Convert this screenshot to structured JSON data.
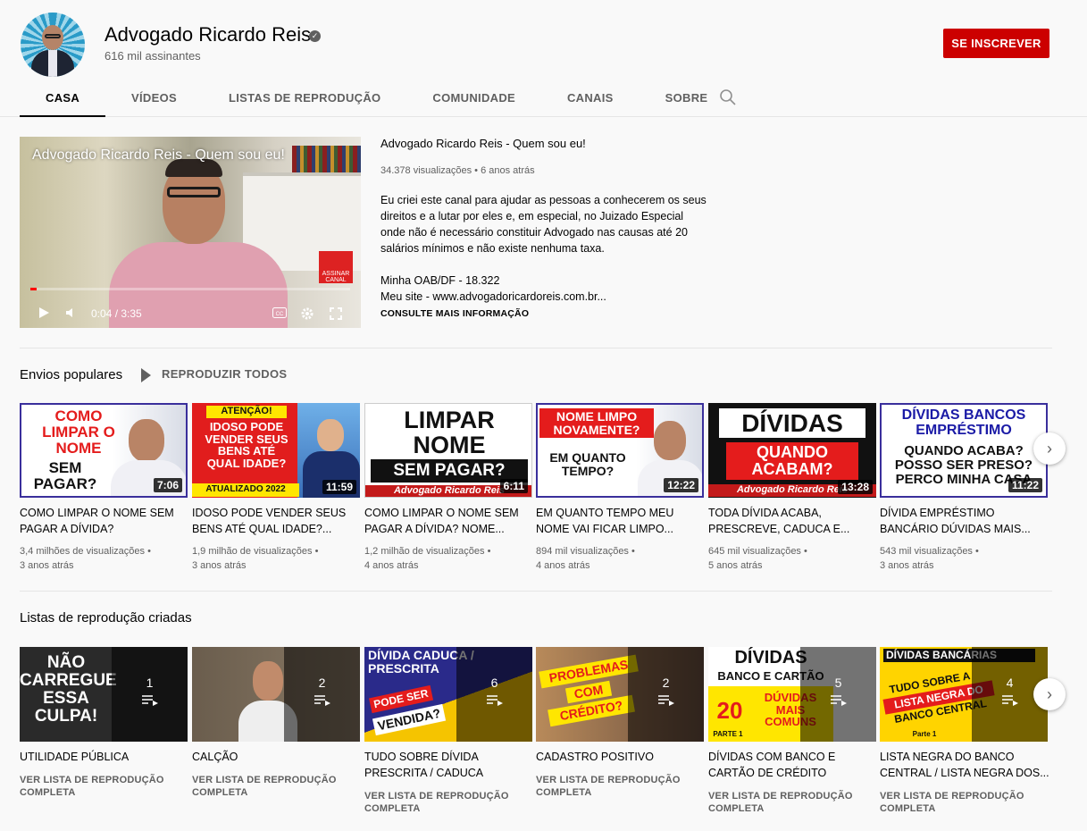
{
  "channel": {
    "name": "Advogado Ricardo Reis",
    "subscribers": "616 mil assinantes",
    "subscribe_label": "SE INSCREVER"
  },
  "tabs": [
    "CASA",
    "VÍDEOS",
    "LISTAS DE REPRODUÇÃO",
    "COMUNIDADE",
    "CANAIS",
    "SOBRE"
  ],
  "featured": {
    "player_title": "Advogado Ricardo Reis - Quem sou eu!",
    "time": "0:04 / 3:35",
    "progress": 0.02,
    "sticker": "ASSINAR CANAL",
    "title": "Advogado Ricardo Reis - Quem sou eu!",
    "views": "34.378 visualizações",
    "age": "6 anos atrás",
    "description": "Eu criei este canal para ajudar as pessoas a conhecerem os seus direitos e a lutar por eles e, em especial, no Juizado Especial onde não é necessário constituir Advogado nas causas até 20 salários mínimos e não existe nenhuma taxa.",
    "oab": "Minha OAB/DF - 18.322",
    "site": "Meu site - www.advogadoricardoreis.com.br...",
    "more_label": "CONSULTE MAIS INFORMAÇÃO"
  },
  "popular": {
    "title": "Envios populares",
    "play_all": "REPRODUZIR TODOS",
    "videos": [
      {
        "thumb": "COMO LIMPAR O NOME SEM PAGAR?",
        "duration": "7:06",
        "title": "COMO LIMPAR O NOME SEM PAGAR A DÍVIDA?",
        "views": "3,4 milhões de visualizações •",
        "age": "3 anos atrás"
      },
      {
        "thumb": "ATENÇÃO! IDOSO PODE VENDER SEUS BENS ATÉ QUAL IDADE? ATUALIZADO 2022",
        "duration": "11:59",
        "title": "IDOSO PODE VENDER SEUS BENS ATÉ QUAL IDADE?...",
        "views": "1,9 milhão de visualizações •",
        "age": "3 anos atrás"
      },
      {
        "thumb": "LIMPAR NOME SEM PAGAR? Advogado Ricardo Reis",
        "duration": "6:11",
        "title": "COMO LIMPAR O NOME SEM PAGAR A DÍVIDA? NOME...",
        "views": "1,2 milhão de visualizações •",
        "age": "4 anos atrás"
      },
      {
        "thumb": "NOME LIMPO NOVAMENTE? EM QUANTO TEMPO?",
        "duration": "12:22",
        "title": "EM QUANTO TEMPO MEU NOME VAI FICAR LIMPO...",
        "views": "894 mil visualizações •",
        "age": "4 anos atrás"
      },
      {
        "thumb": "DÍVIDAS QUANDO ACABAM? Advogado Ricardo Reis",
        "duration": "13:28",
        "title": "TODA DÍVIDA ACABA, PRESCREVE, CADUCA E...",
        "views": "645 mil visualizações •",
        "age": "5 anos atrás"
      },
      {
        "thumb": "DÍVIDAS BANCOS EMPRÉSTIMO QUANDO ACABA? POSSO SER PRESO? PERCO MINHA CASA",
        "duration": "11:22",
        "title": "DÍVIDA EMPRÉSTIMO BANCÁRIO DÚVIDAS MAIS...",
        "views": "543 mil visualizações •",
        "age": "3 anos atrás"
      }
    ]
  },
  "playlists": {
    "title": "Listas de reprodução criadas",
    "link_label": "VER LISTA DE REPRODUÇÃO COMPLETA",
    "items": [
      {
        "thumb": "NÃO CARREGUE ESSA CULPA!",
        "count": "1",
        "title": "UTILIDADE PÚBLICA"
      },
      {
        "thumb": "",
        "count": "2",
        "title": "CALÇÃO"
      },
      {
        "thumb": "DÍVIDA CADUCA / PRESCRITA PODE SER VENDIDA?",
        "count": "6",
        "title": "TUDO SOBRE DÍVIDA PRESCRITA / CADUCA"
      },
      {
        "thumb": "PROBLEMAS COM CRÉDITO?",
        "count": "2",
        "title": "CADASTRO POSITIVO"
      },
      {
        "thumb": "DÍVIDAS BANCO E CARTÃO 20 DÚVIDAS MAIS COMUNS PARTE 1",
        "count": "5",
        "title": "DÍVIDAS COM BANCO E CARTÃO DE CRÉDITO"
      },
      {
        "thumb": "DÍVIDAS BANCÁRIAS TUDO SOBRE A LISTA NEGRA DO BANCO CENTRAL Parte 1",
        "count": "4",
        "title": "LISTA NEGRA DO BANCO CENTRAL / LISTA NEGRA DOS..."
      }
    ]
  },
  "colors": {
    "brand": "#cc0000",
    "accent_blue": "#1a1aa6",
    "text_secondary": "#606060"
  }
}
